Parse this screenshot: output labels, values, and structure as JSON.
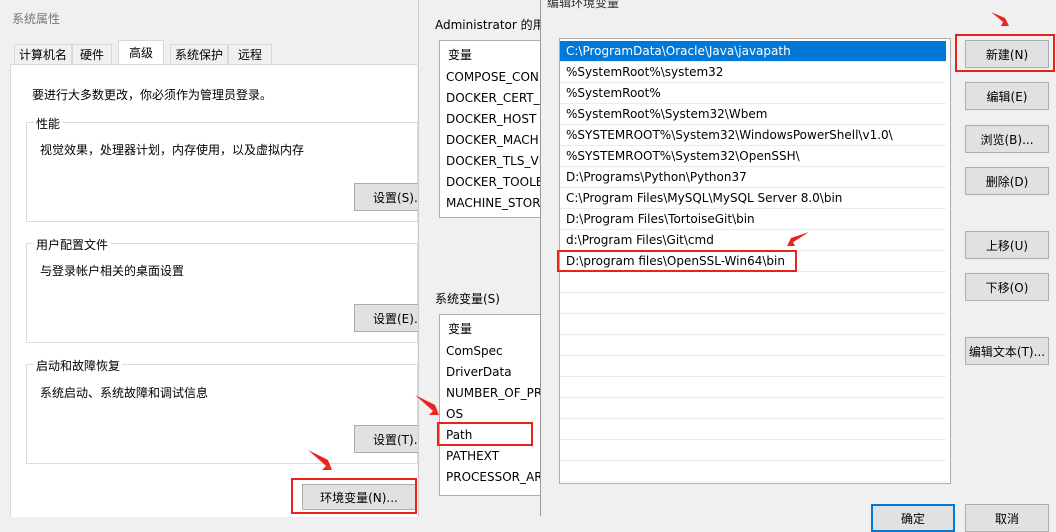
{
  "sysprops": {
    "title": "系统属性",
    "tabs": [
      "计算机名",
      "硬件",
      "高级",
      "系统保护",
      "远程"
    ],
    "admin_note": "要进行大多数更改，你必须作为管理员登录。",
    "perf": {
      "title": "性能",
      "desc": "视觉效果，处理器计划，内存使用，以及虚拟内存",
      "btn": "设置(S)..."
    },
    "profile": {
      "title": "用户配置文件",
      "desc": "与登录帐户相关的桌面设置",
      "btn": "设置(E)..."
    },
    "startup": {
      "title": "启动和故障恢复",
      "desc": "系统启动、系统故障和调试信息",
      "btn": "设置(T)..."
    },
    "env_btn": "环境变量(N)..."
  },
  "envvars": {
    "user_section": "Administrator 的用",
    "user_header": "变量",
    "user_vars": [
      "COMPOSE_CON",
      "DOCKER_CERT_",
      "DOCKER_HOST",
      "DOCKER_MACH",
      "DOCKER_TLS_VE",
      "DOCKER_TOOLE",
      "MACHINE_STOR"
    ],
    "sys_section": "系统变量(S)",
    "sys_header": "变量",
    "sys_vars": [
      "ComSpec",
      "DriverData",
      "NUMBER_OF_PR",
      "OS",
      "Path",
      "PATHEXT",
      "PROCESSOR_AR"
    ]
  },
  "editenv": {
    "title": "编辑环境变量",
    "paths": [
      "C:\\ProgramData\\Oracle\\Java\\javapath",
      "%SystemRoot%\\system32",
      "%SystemRoot%",
      "%SystemRoot%\\System32\\Wbem",
      "%SYSTEMROOT%\\System32\\WindowsPowerShell\\v1.0\\",
      "%SYSTEMROOT%\\System32\\OpenSSH\\",
      "D:\\Programs\\Python\\Python37",
      "C:\\Program Files\\MySQL\\MySQL Server 8.0\\bin",
      "D:\\Program Files\\TortoiseGit\\bin",
      "d:\\Program Files\\Git\\cmd",
      "D:\\program files\\OpenSSL-Win64\\bin"
    ],
    "buttons": {
      "new": "新建(N)",
      "edit": "编辑(E)",
      "browse": "浏览(B)...",
      "delete": "删除(D)",
      "up": "上移(U)",
      "down": "下移(O)",
      "edit_text": "编辑文本(T)...",
      "ok": "确定",
      "cancel": "取消"
    }
  },
  "colors": {
    "highlight": "#e8231c",
    "selection": "#0078d7",
    "dialog_bg": "#f0f0f0"
  }
}
